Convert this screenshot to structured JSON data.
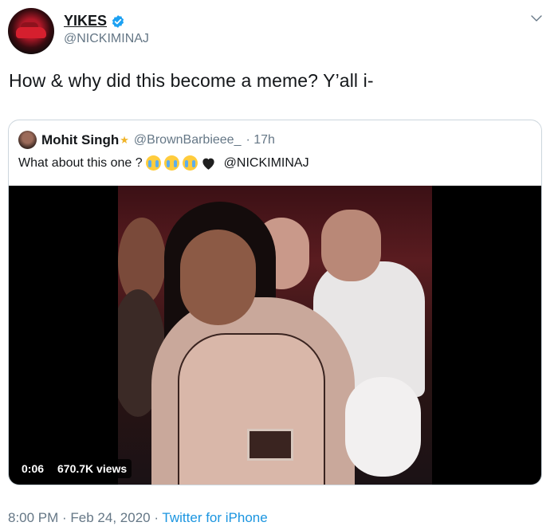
{
  "author": {
    "display_name": "YIKES",
    "handle": "@NICKIMINAJ",
    "verified_icon": "verified-badge-icon"
  },
  "tweet": {
    "text": "How & why did this become a meme? Y’all i-",
    "timestamp": "8:00 PM · Feb 24, 2020",
    "separator": " · ",
    "source": "Twitter for iPhone"
  },
  "quote": {
    "display_name": "Mohit Singh",
    "name_emoji": "★",
    "handle": "@BrownBarbieee_",
    "time": "· 17h",
    "text": "What about this one ?",
    "emojis": [
      "loudly-crying-face",
      "loudly-crying-face",
      "loudly-crying-face",
      "black-heart"
    ],
    "mention": "@NICKIMINAJ",
    "video": {
      "duration": "0:06",
      "views": "670.7K views"
    }
  },
  "colors": {
    "text": "#14171a",
    "secondary": "#657786",
    "link": "#1b95e0",
    "border": "#ccd6dd",
    "verified": "#1da1f2"
  }
}
